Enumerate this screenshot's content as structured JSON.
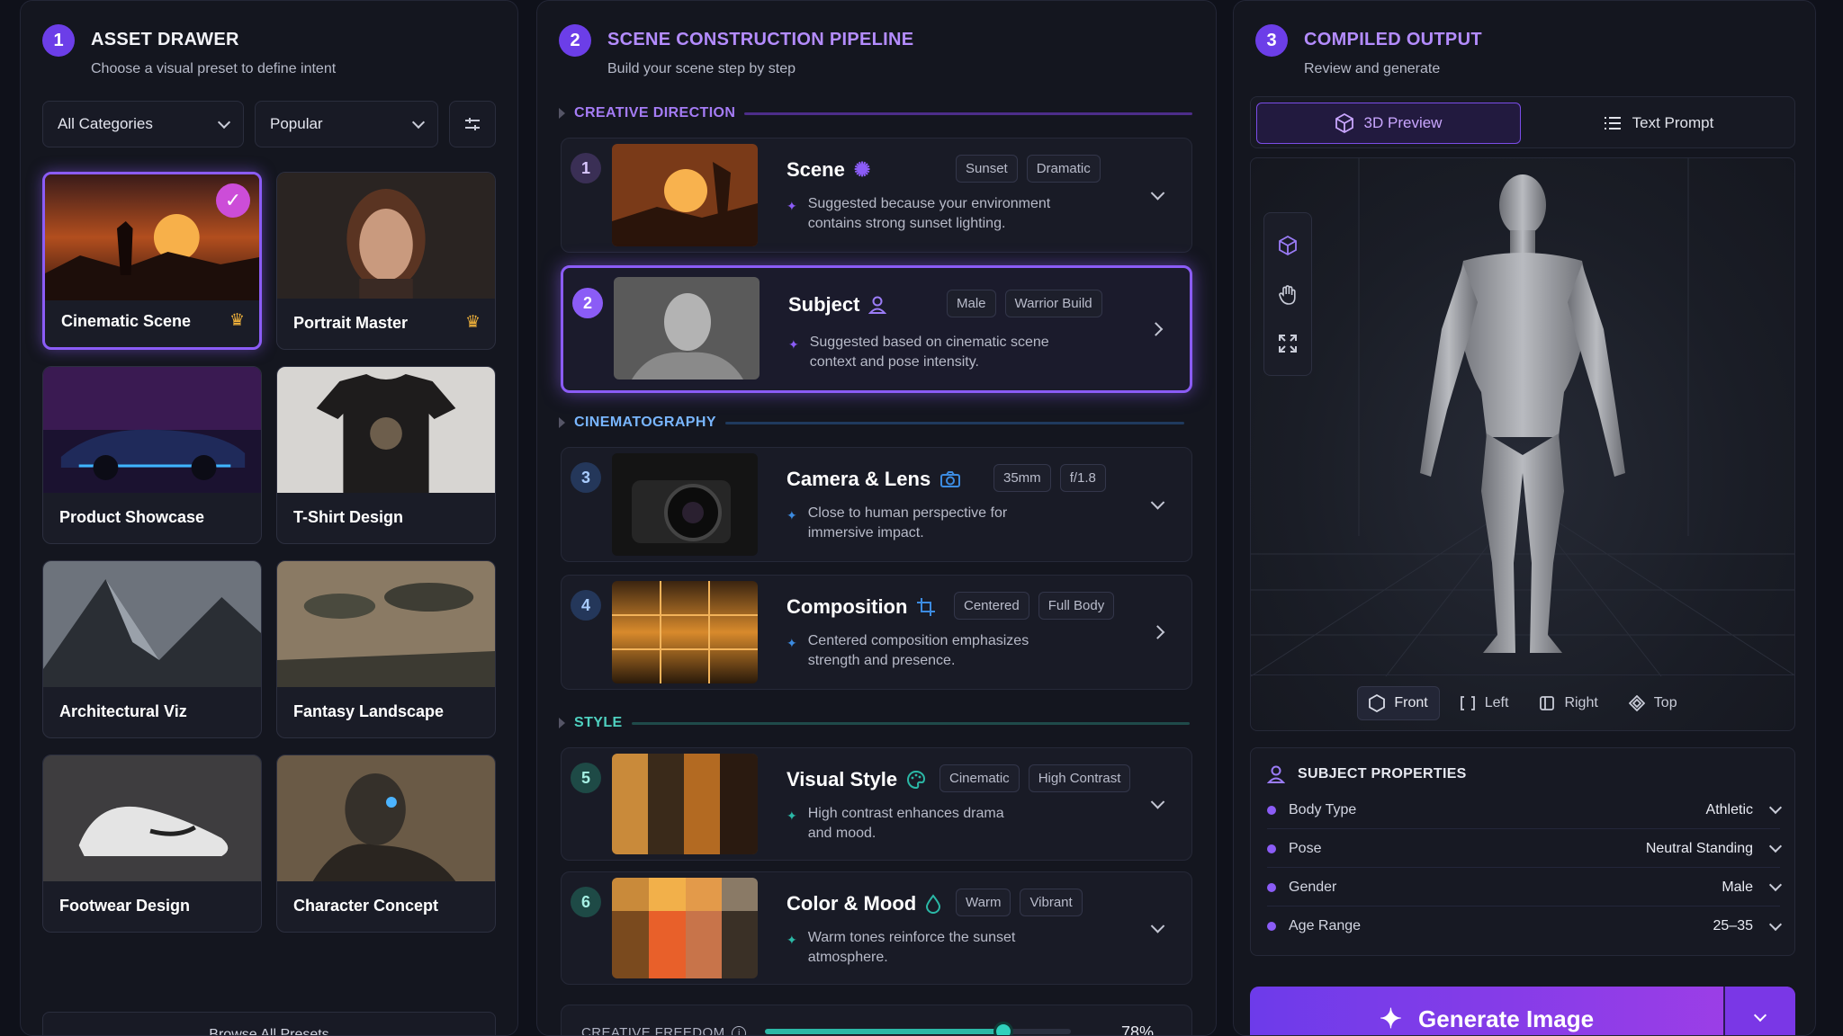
{
  "asset_drawer": {
    "number": "1",
    "title": "ASSET DRAWER",
    "subtitle": "Choose a visual preset to define intent",
    "category_select": "All Categories",
    "sort_select": "Popular",
    "presets": [
      {
        "label": "Cinematic Scene",
        "selected": true,
        "premium": true
      },
      {
        "label": "Portrait Master",
        "selected": false,
        "premium": true
      },
      {
        "label": "Product Showcase",
        "selected": false,
        "premium": false
      },
      {
        "label": "T-Shirt Design",
        "selected": false,
        "premium": false
      },
      {
        "label": "Architectural Viz",
        "selected": false,
        "premium": false
      },
      {
        "label": "Fantasy Landscape",
        "selected": false,
        "premium": false
      },
      {
        "label": "Footwear Design",
        "selected": false,
        "premium": false
      },
      {
        "label": "Character Concept",
        "selected": false,
        "premium": false
      }
    ],
    "bottom_button": "Browse All Presets"
  },
  "pipeline": {
    "number": "2",
    "title": "SCENE CONSTRUCTION PIPELINE",
    "subtitle": "Build your scene step by step",
    "sections": {
      "creative_direction": "CREATIVE DIRECTION",
      "cinematography": "CINEMATOGRAPHY",
      "style": "STYLE"
    },
    "steps": [
      {
        "num": "1",
        "title": "Scene",
        "tags": [
          "Sunset",
          "Dramatic"
        ],
        "desc1": "Suggested because your environment",
        "desc2": "contains strong sunset lighting."
      },
      {
        "num": "2",
        "title": "Subject",
        "tags": [
          "Male",
          "Warrior Build"
        ],
        "desc1": "Suggested based on cinematic scene",
        "desc2": "context and pose intensity."
      },
      {
        "num": "3",
        "title": "Camera & Lens",
        "tags": [
          "35mm",
          "f/1.8"
        ],
        "desc1": "Close to human perspective for",
        "desc2": "immersive impact."
      },
      {
        "num": "4",
        "title": "Composition",
        "tags": [
          "Centered",
          "Full Body"
        ],
        "desc1": "Centered composition emphasizes",
        "desc2": "strength and presence."
      },
      {
        "num": "5",
        "title": "Visual Style",
        "tags": [
          "Cinematic",
          "High Contrast"
        ],
        "desc1": "High contrast enhances drama",
        "desc2": "and mood."
      },
      {
        "num": "6",
        "title": "Color & Mood",
        "tags": [
          "Warm",
          "Vibrant"
        ],
        "desc1": "Warm tones reinforce the sunset",
        "desc2": "atmosphere."
      }
    ],
    "creative_freedom": {
      "label": "CREATIVE FREEDOM",
      "value": 0.78,
      "value_text": "78%"
    }
  },
  "output": {
    "number": "3",
    "title": "COMPILED OUTPUT",
    "subtitle": "Review and generate",
    "tab_preview": "3D Preview",
    "tab_text": "Text Prompt",
    "views": [
      "Front",
      "Left",
      "Right",
      "Top"
    ],
    "props_title": "SUBJECT PROPERTIES",
    "properties": [
      {
        "key": "Body Type",
        "value": "Athletic"
      },
      {
        "key": "Pose",
        "value": "Neutral Standing"
      },
      {
        "key": "Gender",
        "value": "Male"
      },
      {
        "key": "Age Range",
        "value": "25–35"
      }
    ],
    "generate": "Generate Image"
  },
  "colors": {
    "accent": "#8b5cf6",
    "teal": "#2bb8a6",
    "blue": "#3c8be0",
    "crown": "#f5b53b",
    "check": "#cc4dd8"
  },
  "icons": [
    "check-icon",
    "crown-icon",
    "chevron-down-icon",
    "filter-icon",
    "sparkle-icon",
    "person-icon",
    "camera-icon",
    "crop-icon",
    "palette-icon",
    "drop-icon",
    "cube-icon",
    "hand-icon",
    "expand-icon",
    "list-icon",
    "info-icon"
  ]
}
